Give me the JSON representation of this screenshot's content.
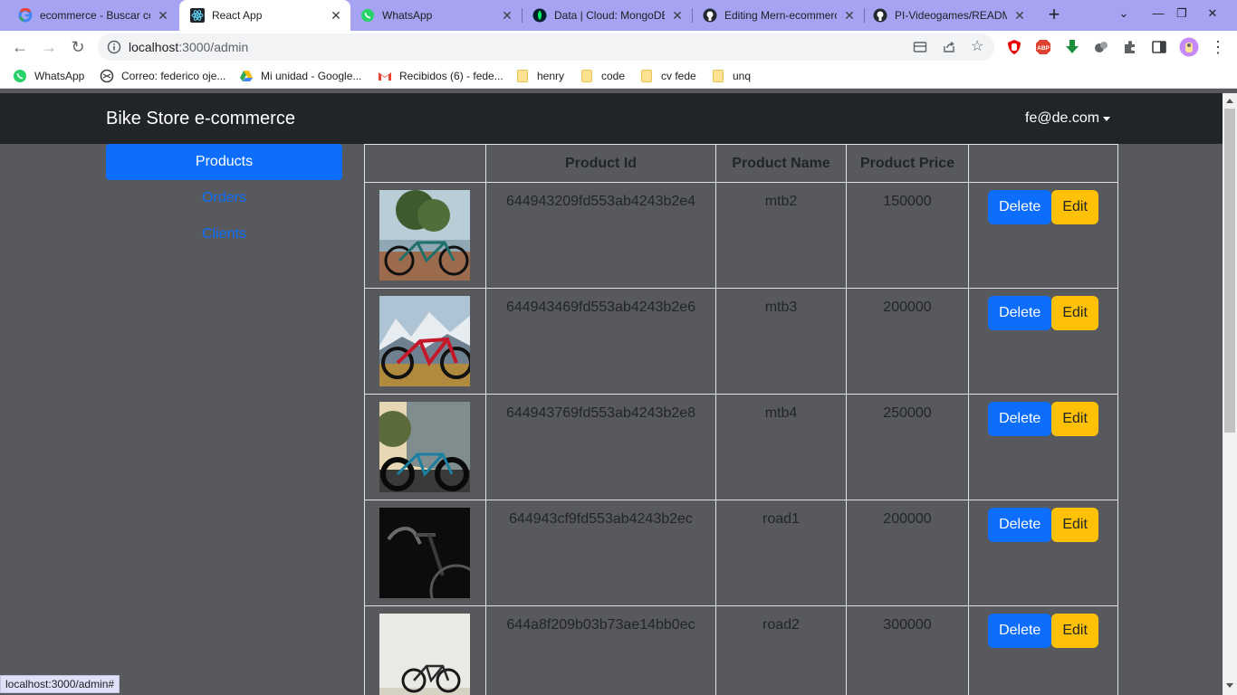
{
  "browser": {
    "tabs": [
      {
        "label": "ecommerce - Buscar con Google",
        "icon": "google-icon",
        "active": false
      },
      {
        "label": "React App",
        "icon": "react-icon",
        "active": true
      },
      {
        "label": "WhatsApp",
        "icon": "whatsapp-icon",
        "active": false
      },
      {
        "label": "Data | Cloud: MongoDB Cloud",
        "icon": "mongodb-icon",
        "active": false
      },
      {
        "label": "Editing Mern-ecommerce",
        "icon": "github-icon",
        "active": false
      },
      {
        "label": "PI-Videogames/README.md",
        "icon": "github-icon",
        "active": false
      }
    ],
    "url_host": "localhost",
    "url_path": ":3000/admin",
    "bookmarks": [
      {
        "label": "WhatsApp",
        "icon": "whatsapp-icon"
      },
      {
        "label": "Correo: federico oje...",
        "icon": "outlook-icon"
      },
      {
        "label": "Mi unidad - Google...",
        "icon": "google-drive-icon"
      },
      {
        "label": "Recibidos (6) - fede...",
        "icon": "gmail-icon"
      },
      {
        "label": "henry",
        "icon": "folder-icon"
      },
      {
        "label": "code",
        "icon": "folder-icon"
      },
      {
        "label": "cv fede",
        "icon": "folder-icon"
      },
      {
        "label": "unq",
        "icon": "folder-icon"
      }
    ],
    "status_url": "localhost:3000/admin#",
    "colors": {
      "tabstrip": "#a6a3f3",
      "active_tab": "#ffffff"
    }
  },
  "app": {
    "brand": "Bike Store e-commerce",
    "user_email": "fe@de.com",
    "sidebar": [
      {
        "label": "Products",
        "active": true
      },
      {
        "label": "Orders",
        "active": false
      },
      {
        "label": "Clients",
        "active": false
      }
    ],
    "table": {
      "headers": [
        "",
        "Product Id",
        "Product Name",
        "Product Price",
        ""
      ],
      "rows": [
        {
          "id": "644943209fd553ab4243b2e4",
          "name": "mtb2",
          "price": "150000",
          "image": "bike-photo-green-mtb"
        },
        {
          "id": "644943469fd553ab4243b2e6",
          "name": "mtb3",
          "price": "200000",
          "image": "bike-photo-red-mtb"
        },
        {
          "id": "644943769fd553ab4243b2e8",
          "name": "mtb4",
          "price": "250000",
          "image": "bike-photo-fatbike"
        },
        {
          "id": "644943cf9fd553ab4243b2ec",
          "name": "road1",
          "price": "200000",
          "image": "bike-photo-dark-road"
        },
        {
          "id": "644a8f209b03b73ae14bb0ec",
          "name": "road2",
          "price": "300000",
          "image": "bike-photo-white-road"
        }
      ],
      "delete_label": "Delete",
      "edit_label": "Edit"
    },
    "colors": {
      "navbar": "#212529",
      "background": "#58595c",
      "primary": "#0d6efd",
      "warning": "#ffc107"
    }
  }
}
